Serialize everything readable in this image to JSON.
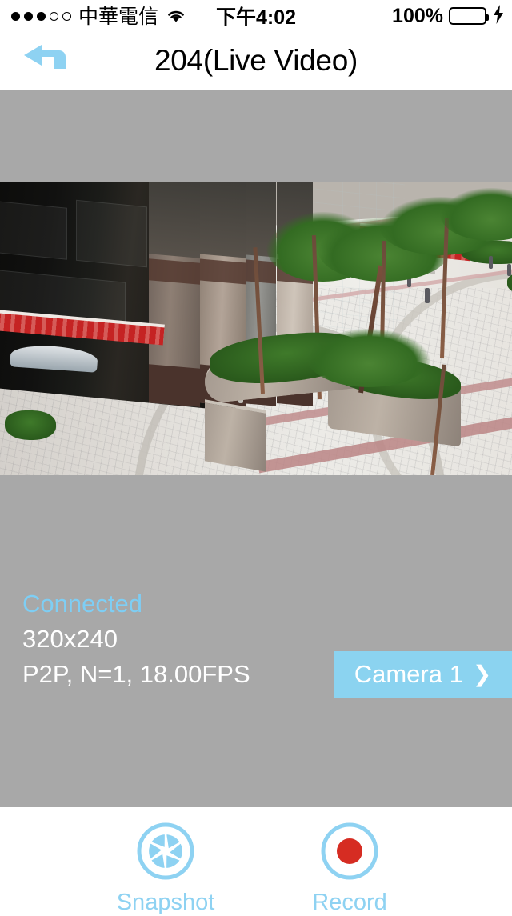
{
  "status_bar": {
    "signal_dots_filled": 3,
    "signal_dots_total": 5,
    "carrier": "中華電信",
    "wifi_icon": "wifi-icon",
    "time": "下午4:02",
    "battery_percent": "100%",
    "battery_state": "charging",
    "battery_color": "#4CD964",
    "charging_icon": "lightning-bolt-icon"
  },
  "nav_bar": {
    "back_icon": "back-arrow-icon",
    "back_color": "#8ed2f2",
    "title": "204(Live Video)"
  },
  "video": {
    "letterbox_color": "#a8a8a8",
    "description": "live cctv view of an outdoor shopping plaza with trees, hedges and tiled paving"
  },
  "overlay": {
    "connection_status": "Connected",
    "connection_status_color": "#7ecef4",
    "resolution": "320x240",
    "stream_info": "P2P, N=1, 18.00FPS",
    "camera_button": {
      "label": "Camera 1",
      "chevron": "❯",
      "background": "#8bd3f0"
    }
  },
  "toolbar": {
    "items": [
      {
        "label": "Snapshot",
        "icon": "aperture-icon",
        "color": "#8ed2f2"
      },
      {
        "label": "Record",
        "icon": "record-dot-icon",
        "color": "#8ed2f2",
        "dot_color": "#d62c22"
      }
    ]
  }
}
